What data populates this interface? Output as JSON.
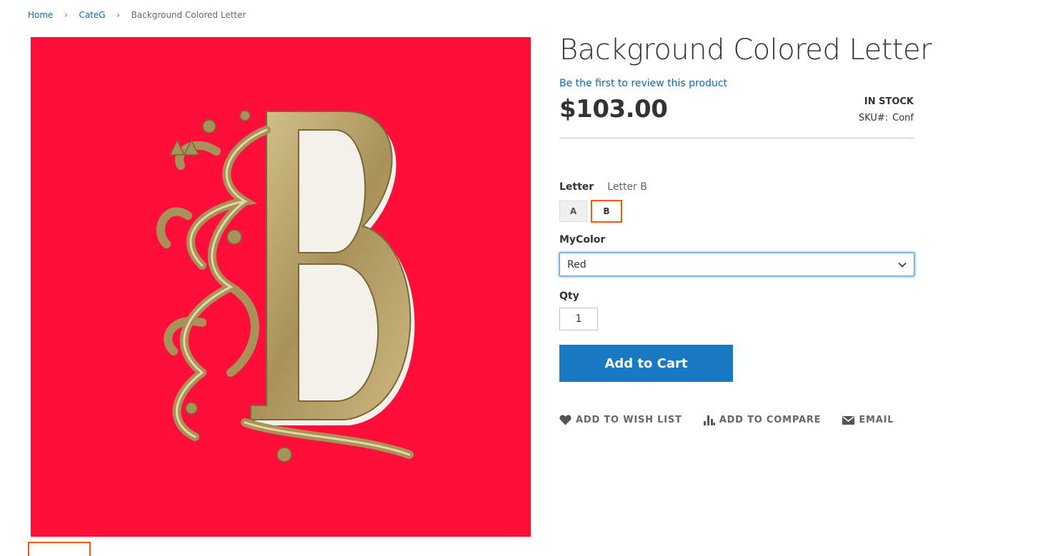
{
  "breadcrumb": {
    "items": [
      "Home",
      "CateG"
    ],
    "current": "Background Colored Letter",
    "separator": ">"
  },
  "product": {
    "title": "Background Colored Letter",
    "review_link": "Be the first to review this product",
    "price": "$103.00",
    "stock": "IN STOCK",
    "sku_label": "SKU#:",
    "sku_value": "Conf",
    "image_background_color": "#fe0e39",
    "image_letter": "B"
  },
  "options": {
    "letter": {
      "label": "Letter",
      "selected_label": "Letter B",
      "swatches": [
        "A",
        "B"
      ],
      "selected": "B"
    },
    "color": {
      "label": "MyColor",
      "selected": "Red"
    }
  },
  "qty": {
    "label": "Qty",
    "value": "1"
  },
  "actions": {
    "add_to_cart": "Add to Cart",
    "wishlist": "Add to Wish List",
    "compare": "Add to Compare",
    "email": "Email"
  },
  "colors": {
    "link": "#006bb4",
    "primary_button": "#1979c3",
    "swatch_selected_border": "#ff5501",
    "gold": "#a8925a"
  },
  "icons": {
    "wishlist": "heart-icon",
    "compare": "bar-chart-icon",
    "email": "envelope-icon",
    "select": "chevron-down-icon",
    "breadcrumb_separator": "chevron-right-icon"
  }
}
